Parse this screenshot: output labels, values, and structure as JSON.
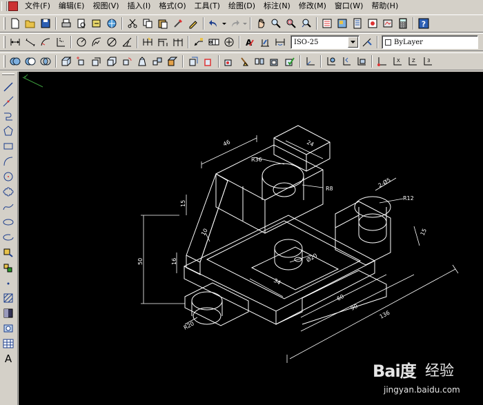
{
  "menu": {
    "items": [
      "文件(F)",
      "编辑(E)",
      "视图(V)",
      "插入(I)",
      "格式(O)",
      "工具(T)",
      "绘图(D)",
      "标注(N)",
      "修改(M)",
      "窗口(W)",
      "帮助(H)"
    ]
  },
  "toolbar": {
    "dimstyle_value": "ISO-25",
    "layer_value": "ByLayer"
  },
  "left_tools": {
    "text_tool_label": "A"
  },
  "drawing": {
    "dims": {
      "d46": "46",
      "d24": "24",
      "r36": "R36",
      "r8": "R8",
      "hole": "2-Ø5",
      "r12": "R12",
      "d15a": "15",
      "d15b": "15",
      "d10": "10",
      "d50": "50",
      "d16": "16",
      "d20": "Ø20",
      "d34": "34",
      "d60": "60",
      "d90": "90",
      "d136": "136",
      "r20": "R20"
    }
  },
  "watermark": {
    "brand": "Bai度",
    "brand_cn": "经验",
    "domain": "jingyan.baidu.com"
  },
  "colors": {
    "chrome": "#d4d0c8",
    "canvas": "#000000",
    "drawing_lines": "#ffffff",
    "ucs_icon": "#3c9a3c"
  }
}
